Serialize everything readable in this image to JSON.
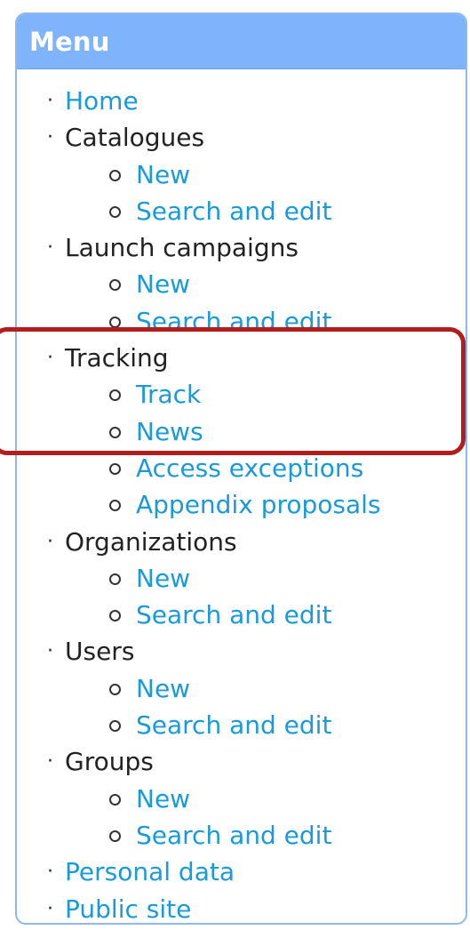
{
  "menu": {
    "title": "Menu",
    "items": [
      {
        "label": "Home",
        "link": true,
        "sub": []
      },
      {
        "label": "Catalogues",
        "link": false,
        "sub": [
          "New",
          "Search and edit"
        ]
      },
      {
        "label": "Launch campaigns",
        "link": false,
        "sub": [
          "New",
          "Search and edit"
        ]
      },
      {
        "label": "Tracking",
        "link": false,
        "sub": [
          "Track",
          "News",
          "Access exceptions",
          "Appendix proposals"
        ]
      },
      {
        "label": "Organizations",
        "link": false,
        "sub": [
          "New",
          "Search and edit"
        ]
      },
      {
        "label": "Users",
        "link": false,
        "sub": [
          "New",
          "Search and edit"
        ]
      },
      {
        "label": "Groups",
        "link": false,
        "sub": [
          "New",
          "Search and edit"
        ]
      },
      {
        "label": "Personal data",
        "link": true,
        "sub": []
      },
      {
        "label": "Public site",
        "link": true,
        "sub": []
      }
    ]
  },
  "colors": {
    "header_bg": "#7fb3fb",
    "link": "#1a9ad9",
    "text": "#222222",
    "highlight": "#b01e1e"
  }
}
